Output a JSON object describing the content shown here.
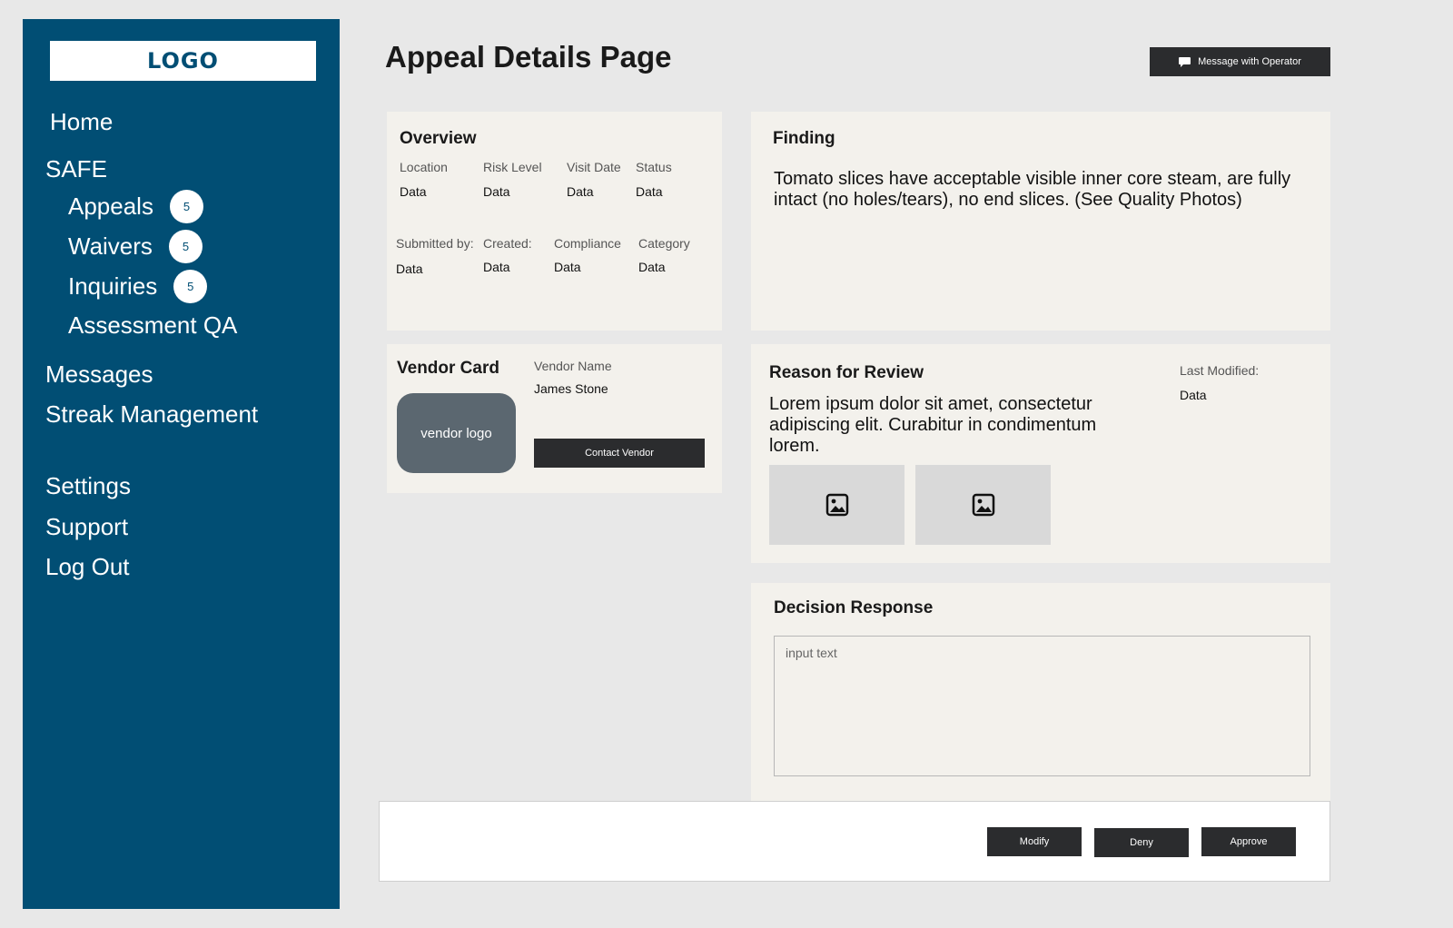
{
  "sidebar": {
    "logo": "LOGO",
    "items": [
      {
        "label": "Home"
      },
      {
        "label": "SAFE"
      },
      {
        "label": "Appeals",
        "badge": "5"
      },
      {
        "label": "Waivers",
        "badge": "5"
      },
      {
        "label": "Inquiries",
        "badge": "5"
      },
      {
        "label": "Assessment QA"
      },
      {
        "label": "Messages"
      },
      {
        "label": "Streak Management"
      },
      {
        "label": "Settings"
      },
      {
        "label": "Support"
      },
      {
        "label": "Log Out"
      }
    ]
  },
  "header": {
    "title": "Appeal Details Page",
    "message_button": "Message with Operator"
  },
  "overview": {
    "title": "Overview",
    "row1": [
      {
        "label": "Location",
        "value": "Data"
      },
      {
        "label": "Risk Level",
        "value": "Data"
      },
      {
        "label": "Visit Date",
        "value": "Data"
      },
      {
        "label": "Status",
        "value": "Data"
      }
    ],
    "row2": [
      {
        "label": "Submitted by:",
        "value": "Data"
      },
      {
        "label": "Created:",
        "value": "Data"
      },
      {
        "label": "Compliance",
        "value": "Data"
      },
      {
        "label": "Category",
        "value": "Data"
      }
    ]
  },
  "finding": {
    "title": "Finding",
    "text": "Tomato slices have acceptable visible inner core steam, are fully intact (no holes/tears), no end slices. (See Quality Photos)"
  },
  "vendor": {
    "title": "Vendor Card",
    "logo_text": "vendor logo",
    "name_label": "Vendor Name",
    "name_value": "James Stone",
    "contact_button": "Contact Vendor"
  },
  "reason": {
    "title": "Reason for Review",
    "text": "Lorem ipsum dolor sit amet, consectetur adipiscing elit. Curabitur in condimentum lorem.",
    "last_modified_label": "Last Modified:",
    "last_modified_value": "Data",
    "photo_icons": [
      "image-icon",
      "image-icon"
    ]
  },
  "decision": {
    "title": "Decision Response",
    "placeholder": "input text",
    "value": ""
  },
  "actions": {
    "modify": "Modify",
    "deny": "Deny",
    "approve": "Approve"
  },
  "colors": {
    "sidebar": "#014e74",
    "card": "#f3f1ec",
    "button": "#2b2c2e",
    "background": "#e8e8e8"
  }
}
